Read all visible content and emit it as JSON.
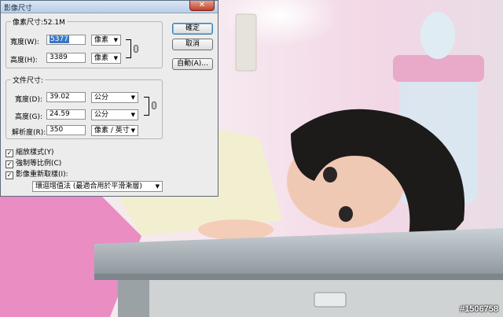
{
  "window": {
    "title": "影像尺寸",
    "close_glyph": "✕"
  },
  "pixel_dimensions": {
    "legend": "像素尺寸:52.1M",
    "width_label": "寬度(W):",
    "width_value": "5377",
    "width_unit": "像素",
    "height_label": "高度(H):",
    "height_value": "3389",
    "height_unit": "像素"
  },
  "document_size": {
    "legend": "文件尺寸:",
    "width_label": "寬度(D):",
    "width_value": "39.02",
    "width_unit": "公分",
    "height_label": "高度(G):",
    "height_value": "24.59",
    "height_unit": "公分",
    "resolution_label": "解析度(R):",
    "resolution_value": "350",
    "resolution_unit": "像素 / 英寸"
  },
  "buttons": {
    "ok": "確定",
    "cancel": "取消",
    "auto": "自動(A)..."
  },
  "options": {
    "scale_styles": "縮放樣式(Y)",
    "constrain_proportions": "強制等比例(C)",
    "resample": "影像重新取樣(I):",
    "resample_method": "環迴增值法 (最適合用於平滑漸層)",
    "scale_styles_checked": true,
    "constrain_checked": true,
    "resample_checked": true
  },
  "watermark": "#1506758",
  "colors": {
    "selection": "#3a77c8",
    "dialog_bg": "#ececec"
  }
}
